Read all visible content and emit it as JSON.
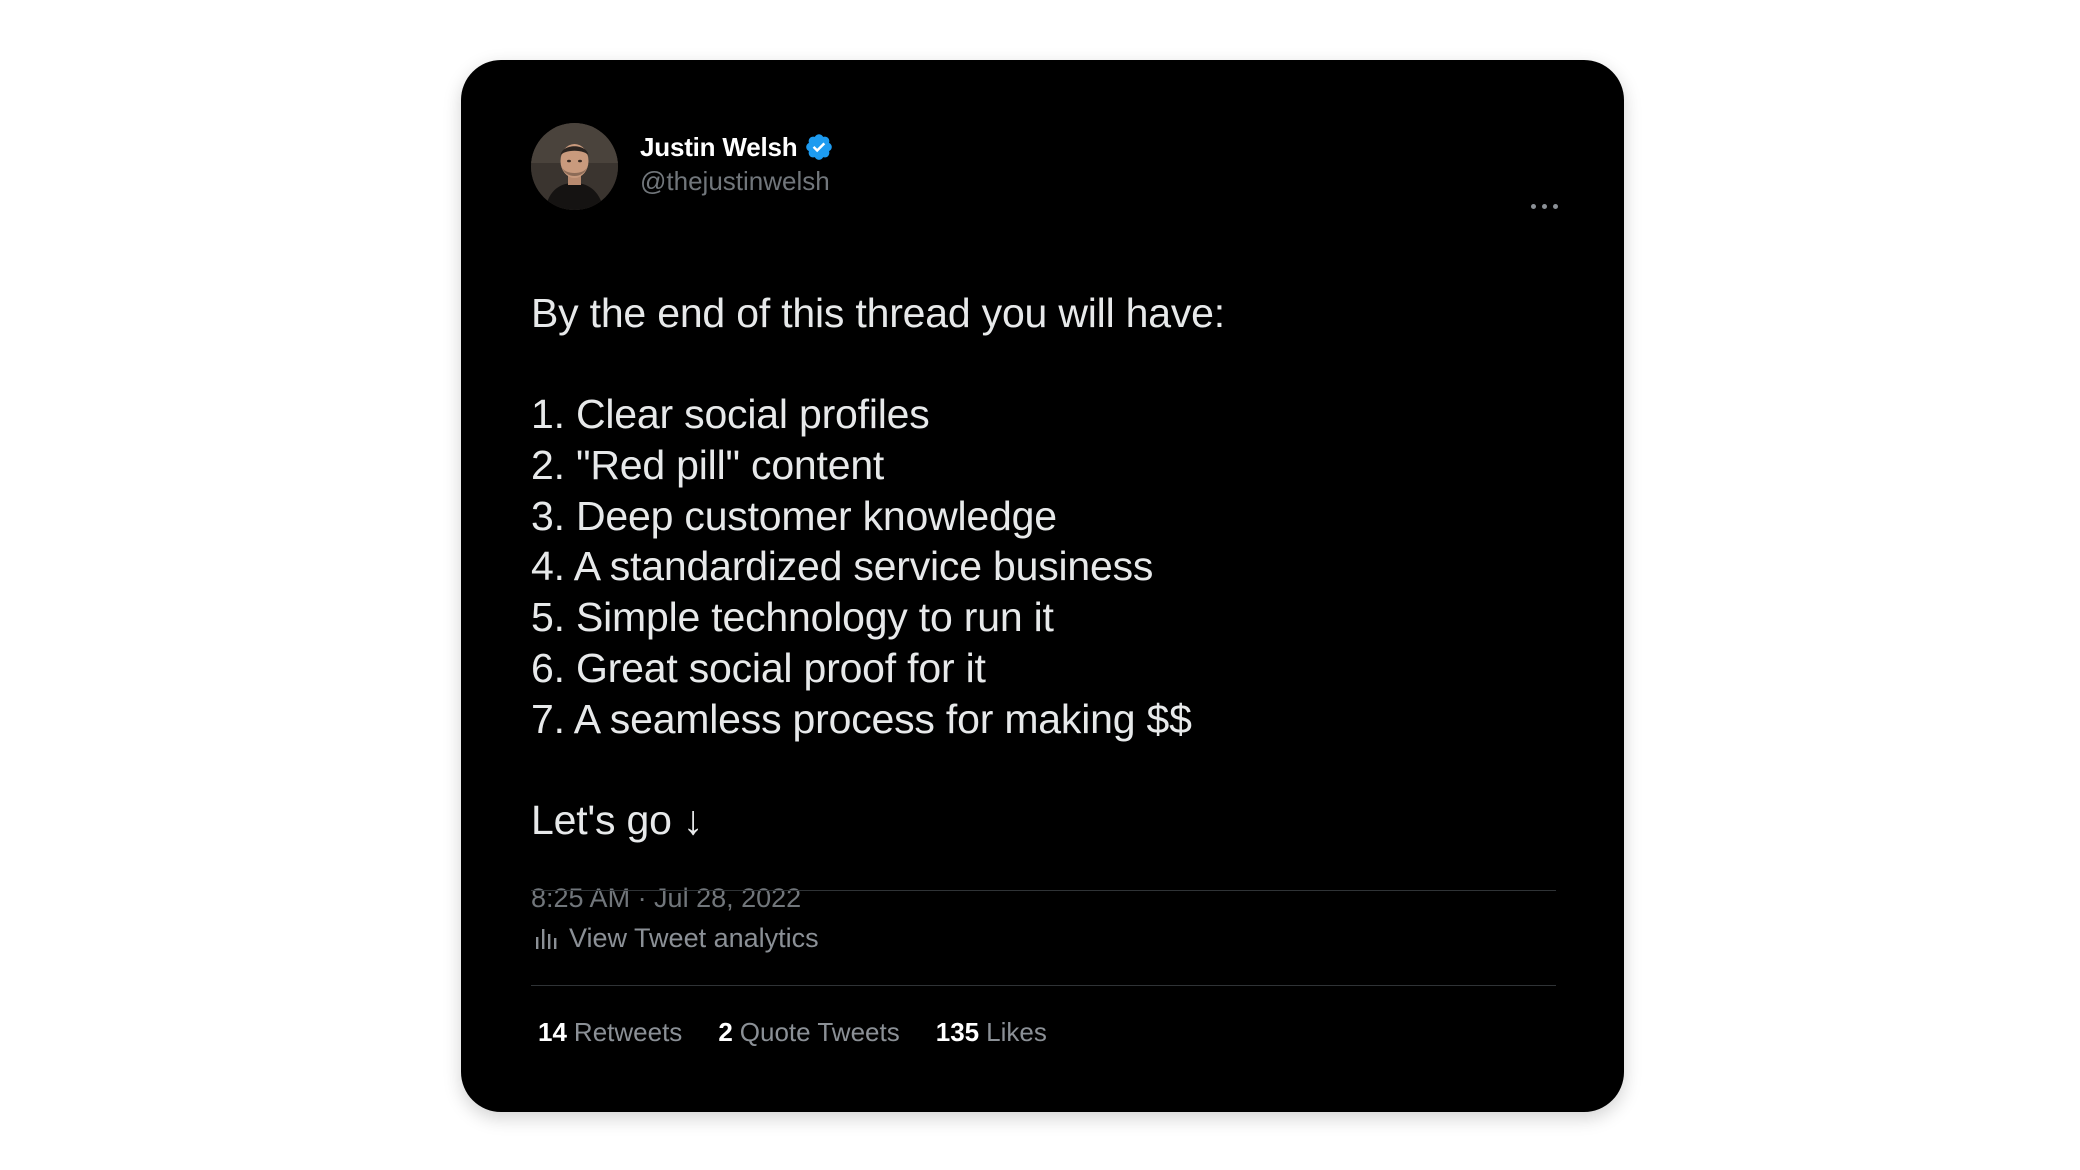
{
  "tweet": {
    "author": {
      "name": "Justin Welsh",
      "handle": "@thejustinwelsh",
      "verified": true,
      "avatar_icon": "profile-photo"
    },
    "menu_icon": "more-horizontal-icon",
    "body_lines": [
      "By the end of this thread you will have:",
      "",
      "1. Clear social profiles",
      "2. \"Red pill\" content",
      "3. Deep customer knowledge",
      "4. A standardized service business",
      "5. Simple technology to run it",
      "6. Great social proof for it",
      "7. A seamless process for making $$",
      "",
      "Let's go ↓"
    ],
    "timestamp": "8:25 AM · Jul 28, 2022",
    "analytics_label": "View Tweet analytics",
    "stats": [
      {
        "count": "14",
        "label": "Retweets"
      },
      {
        "count": "2",
        "label": "Quote Tweets"
      },
      {
        "count": "135",
        "label": "Likes"
      }
    ]
  },
  "colors": {
    "card_bg": "#000000",
    "page_bg": "#ffffff",
    "primary_text": "#e7e9ea",
    "secondary_text": "#71767b",
    "verified_blue": "#1d9bf0",
    "divider": "#2f3336"
  }
}
